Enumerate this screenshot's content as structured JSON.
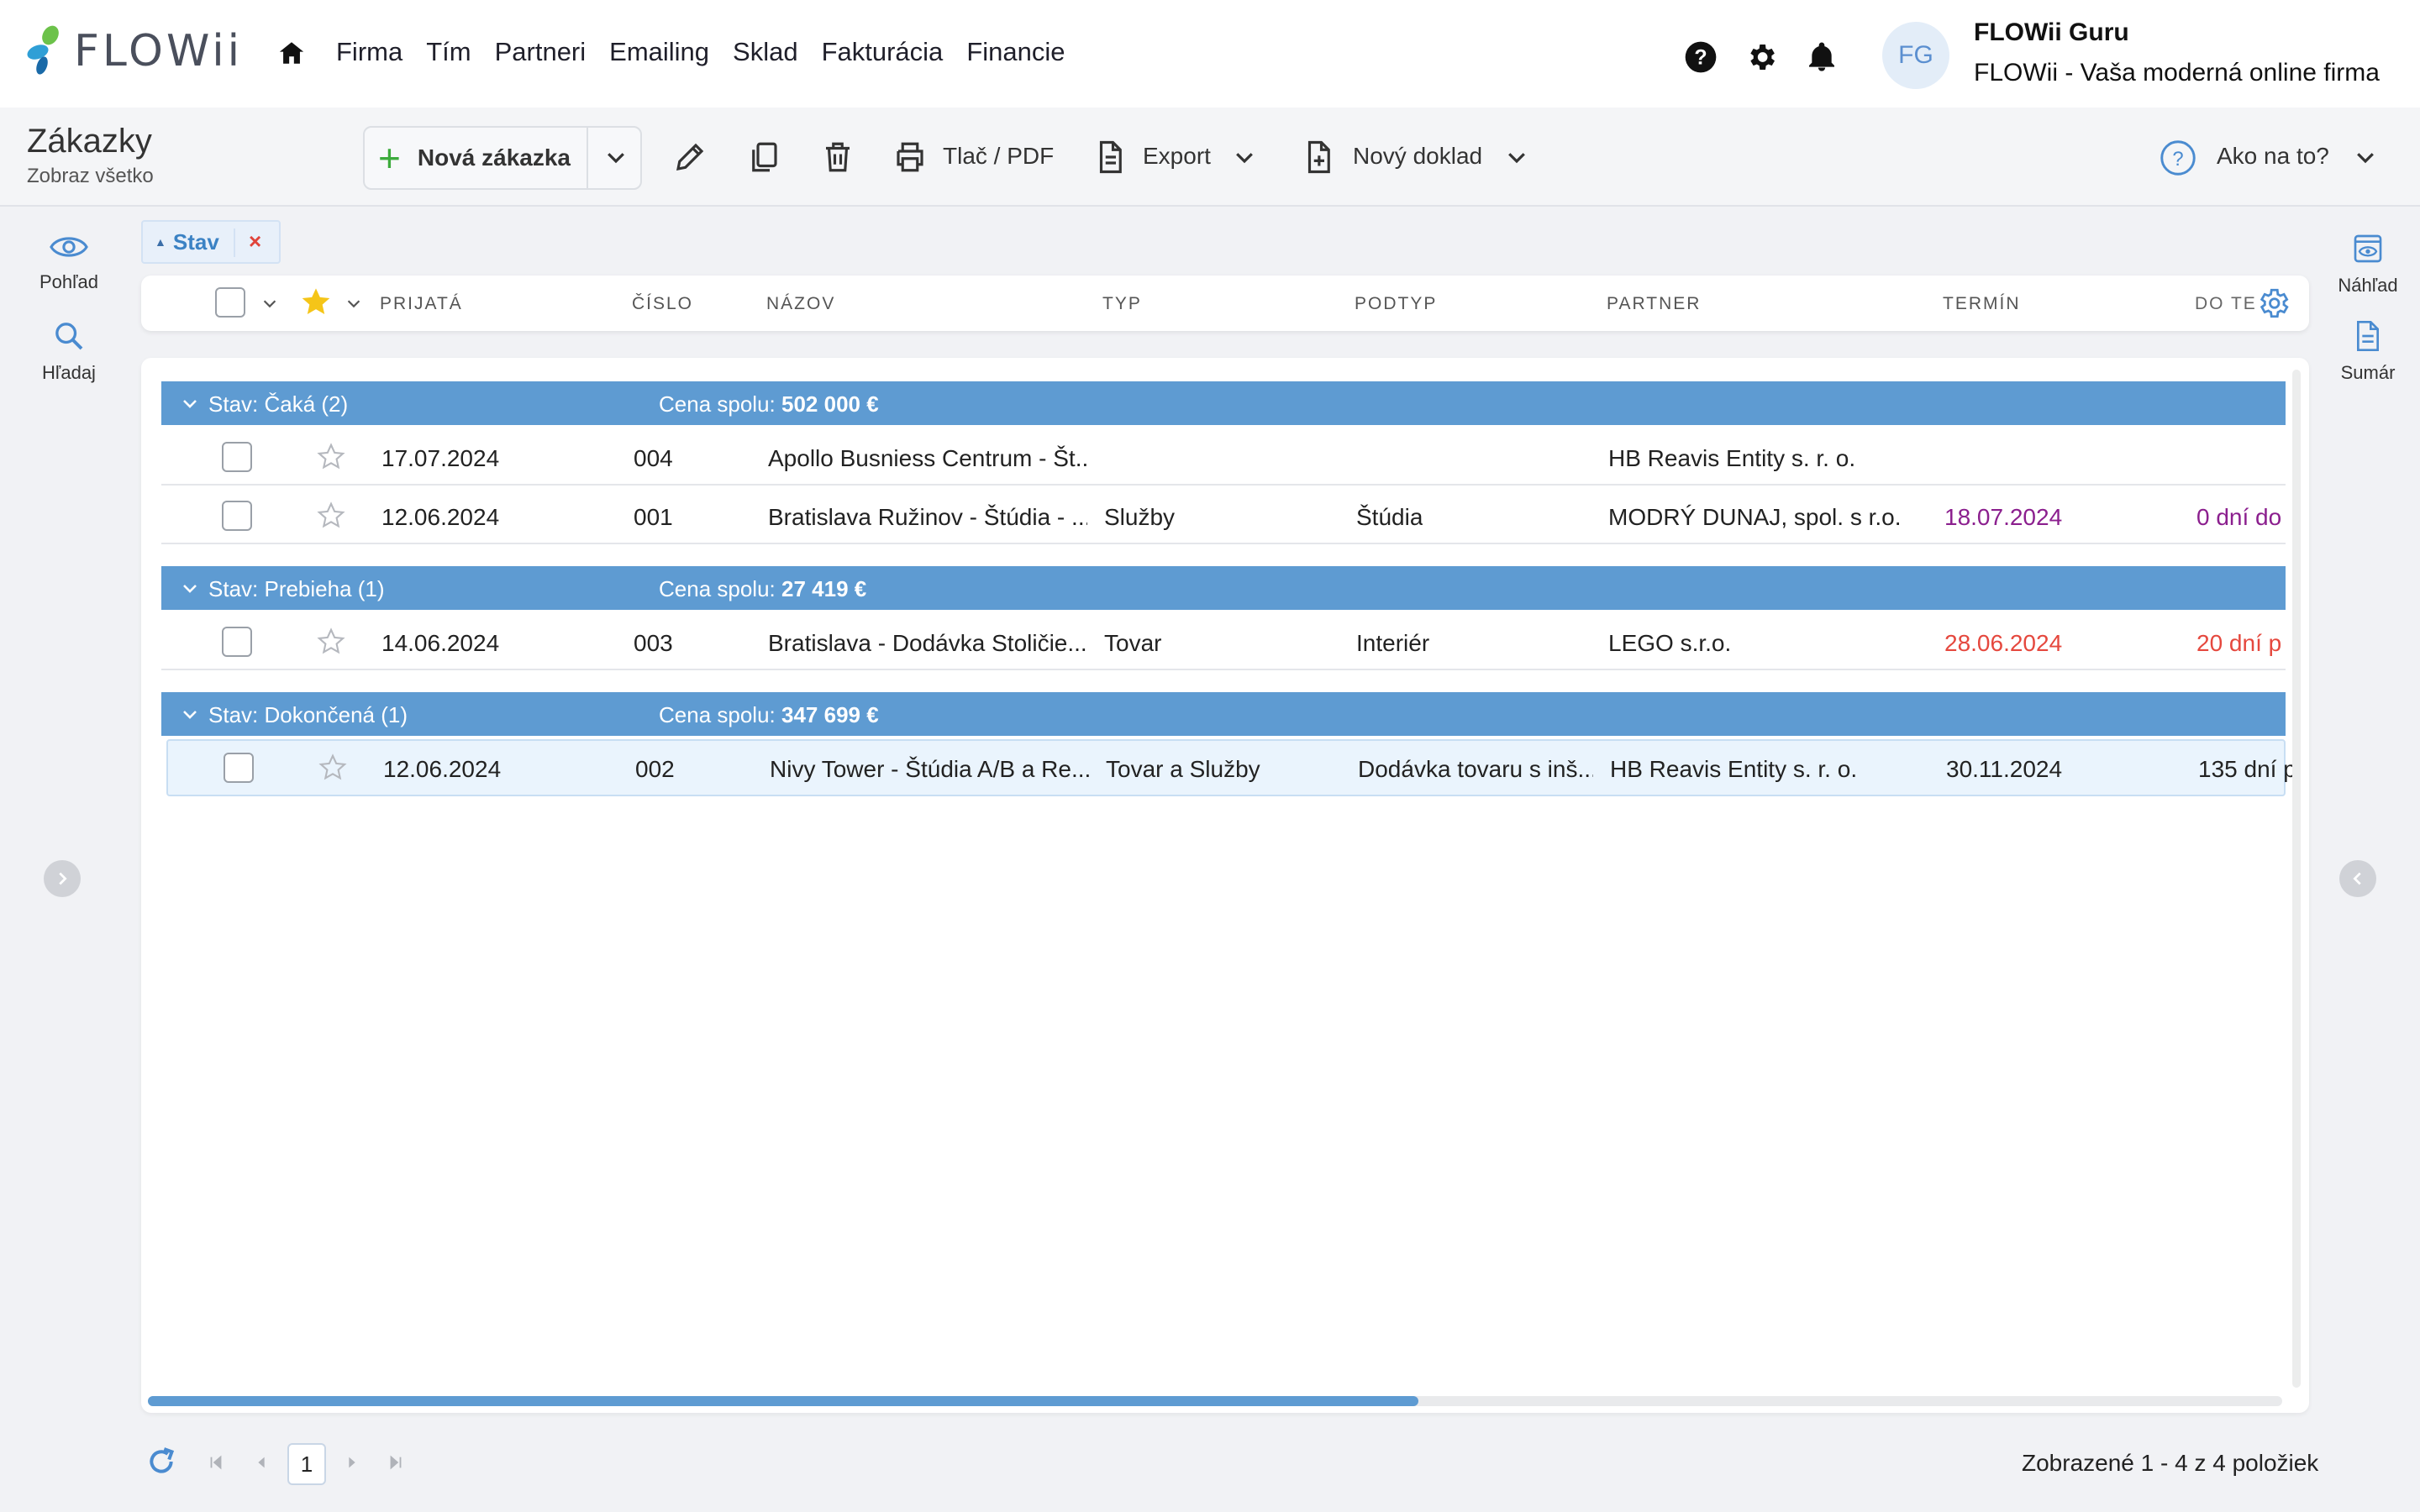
{
  "app": {
    "logo_text": "FLOWii",
    "nav": [
      "Firma",
      "Tím",
      "Partneri",
      "Emailing",
      "Sklad",
      "Fakturácia",
      "Financie"
    ],
    "user_initials": "FG",
    "user_name": "FLOWii Guru",
    "user_company": "FLOWii - Vaša moderná online firma"
  },
  "toolbar": {
    "title": "Zákazky",
    "subtitle": "Zobraz všetko",
    "new_label": "Nová zákazka",
    "print_label": "Tlač / PDF",
    "export_label": "Export",
    "new_doc_label": "Nový doklad",
    "help_label": "Ako na to?"
  },
  "rails": {
    "view": "Pohľad",
    "search": "Hľadaj",
    "preview": "Náhľad",
    "summary": "Sumár"
  },
  "filter": {
    "label": "Stav",
    "remove": "×"
  },
  "columns": [
    "PRIJATÁ",
    "ČÍSLO",
    "NÁZOV",
    "TYP",
    "PODTYP",
    "PARTNER",
    "TERMÍN",
    "DO TE"
  ],
  "groups": [
    {
      "label": "Stav: Čaká (2)",
      "price_label": "Cena spolu:",
      "price_value": "502 000 €",
      "rows": [
        {
          "date": "17.07.2024",
          "num": "004",
          "name": "Apollo Busniess Centrum - Št...",
          "type": "",
          "subtype": "",
          "partner": "HB Reavis Entity s. r. o.",
          "term": "",
          "due": ""
        },
        {
          "date": "12.06.2024",
          "num": "001",
          "name": "Bratislava Ružinov - Štúdia - ...",
          "type": "Služby",
          "subtype": "Štúdia",
          "partner": "MODRÝ DUNAJ, spol. s r.o.",
          "term": "18.07.2024",
          "due": "0 dní do"
        }
      ]
    },
    {
      "label": "Stav: Prebieha (1)",
      "price_label": "Cena spolu:",
      "price_value": "27 419 €",
      "rows": [
        {
          "date": "14.06.2024",
          "num": "003",
          "name": "Bratislava - Dodávka Stoličie...",
          "type": "Tovar",
          "subtype": "Interiér",
          "partner": "LEGO s.r.o.",
          "term": "28.06.2024",
          "due": "20 dní p"
        }
      ]
    },
    {
      "label": "Stav: Dokončená (1)",
      "price_label": "Cena spolu:",
      "price_value": "347 699 €",
      "rows": [
        {
          "date": "12.06.2024",
          "num": "002",
          "name": "Nivy Tower - Štúdia A/B a Re...",
          "type": "Tovar a Služby",
          "subtype": "Dodávka tovaru s inš...",
          "partner": "HB Reavis Entity s. r. o.",
          "term": "30.11.2024",
          "due": "135 dní p"
        }
      ]
    }
  ],
  "pager": {
    "page": "1",
    "info": "Zobrazené 1 - 4 z 4 položiek"
  },
  "colors": {
    "accent": "#5e9bd2",
    "purple_date": "#8b1f8e",
    "red_date": "#e5483e",
    "green_plus": "#3cab3c",
    "star": "#f5c518"
  }
}
